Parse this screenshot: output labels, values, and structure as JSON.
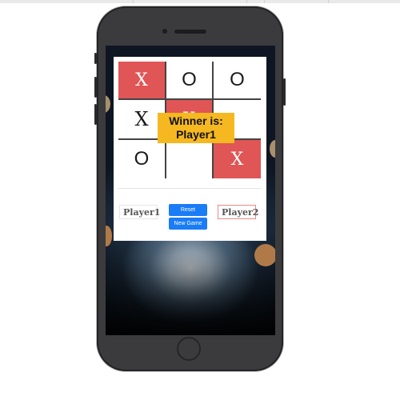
{
  "board": {
    "cells": [
      {
        "mark": "X",
        "style": "filled"
      },
      {
        "mark": "O",
        "style": "plain"
      },
      {
        "mark": "O",
        "style": "plain"
      },
      {
        "mark": "X",
        "style": "plain"
      },
      {
        "mark": "X",
        "style": "filled"
      },
      {
        "mark": "",
        "style": "plain"
      },
      {
        "mark": "O",
        "style": "plain"
      },
      {
        "mark": "",
        "style": "plain"
      },
      {
        "mark": "X",
        "style": "filled"
      }
    ]
  },
  "winner": {
    "line1": "Winner is:",
    "line2": "Player1"
  },
  "players": {
    "player1": "Player1",
    "player2": "Player2"
  },
  "controls": {
    "reset_label": "Reset",
    "new_game_label": "New Game"
  },
  "colors": {
    "win_cell": "#e05555",
    "banner": "#f6b820",
    "button": "#1a7cf6",
    "player2_border": "#e88a8a"
  }
}
